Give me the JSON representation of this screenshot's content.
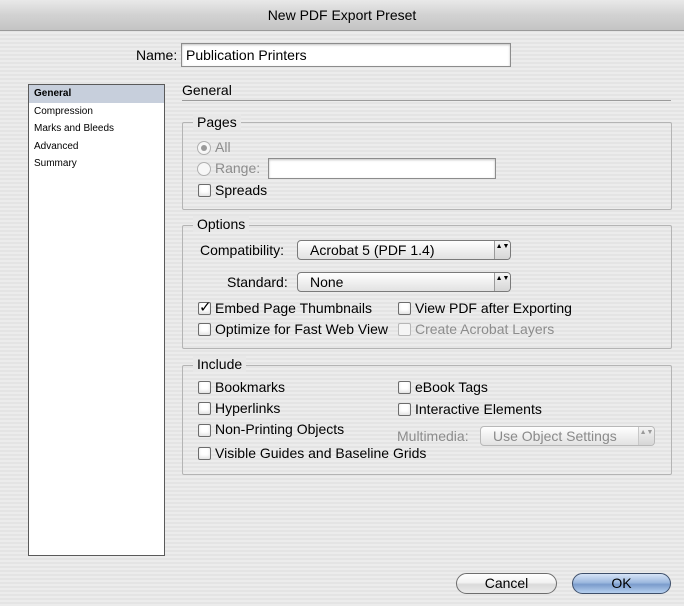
{
  "window": {
    "title": "New PDF Export Preset"
  },
  "name_field": {
    "label": "Name:",
    "value": "Publication Printers"
  },
  "sidebar": {
    "items": [
      {
        "label": "General",
        "selected": true
      },
      {
        "label": "Compression"
      },
      {
        "label": "Marks and Bleeds"
      },
      {
        "label": "Advanced"
      },
      {
        "label": "Summary"
      }
    ]
  },
  "section_title": "General",
  "pages": {
    "title": "Pages",
    "all_label": "All",
    "range_label": "Range:",
    "range_value": "",
    "spreads_label": "Spreads"
  },
  "options": {
    "title": "Options",
    "compatibility_label": "Compatibility:",
    "compatibility_value": "Acrobat 5 (PDF 1.4)",
    "standard_label": "Standard:",
    "standard_value": "None",
    "embed_thumbnails_label": "Embed Page Thumbnails",
    "view_pdf_label": "View PDF after Exporting",
    "optimize_label": "Optimize for Fast Web View",
    "acrobat_layers_label": "Create Acrobat Layers"
  },
  "include": {
    "title": "Include",
    "bookmarks_label": "Bookmarks",
    "hyperlinks_label": "Hyperlinks",
    "nonprinting_label": "Non-Printing Objects",
    "guides_label": "Visible Guides and Baseline Grids",
    "ebook_label": "eBook Tags",
    "interactive_label": "Interactive Elements",
    "multimedia_label": "Multimedia:",
    "multimedia_value": "Use Object Settings"
  },
  "buttons": {
    "cancel": "Cancel",
    "ok": "OK"
  },
  "icons": {
    "checkmark": "✓",
    "popup_arrows": "▲▼"
  },
  "colors": {
    "selection": "#c7cfdc",
    "default_button": "#7b9ccc"
  }
}
